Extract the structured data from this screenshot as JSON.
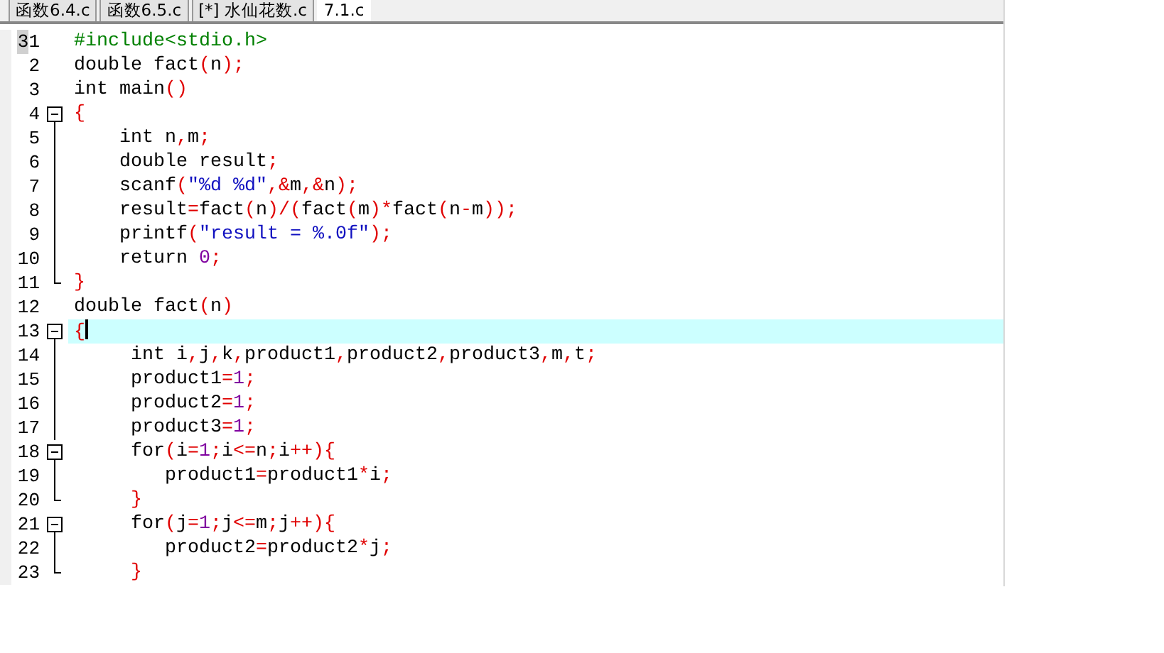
{
  "tabs": [
    {
      "label": "函数6.4.c",
      "selected": false
    },
    {
      "label": "函数6.5.c",
      "selected": false
    },
    {
      "label": "[*] 水仙花数.c",
      "selected": false
    },
    {
      "label": "7.1.c",
      "selected": true
    }
  ],
  "editor": {
    "lines": [
      {
        "number": "1",
        "marker": "3",
        "kind": "plain",
        "current": false,
        "tokens": [
          {
            "text": "#include<stdio.h>",
            "kind": "pre"
          }
        ]
      },
      {
        "number": "2",
        "kind": "plain",
        "current": false,
        "tokens": [
          {
            "text": "double fact",
            "kind": "id"
          },
          {
            "text": "(",
            "kind": "op"
          },
          {
            "text": "n",
            "kind": "id"
          },
          {
            "text": ");",
            "kind": "op"
          }
        ]
      },
      {
        "number": "3",
        "kind": "plain",
        "current": false,
        "tokens": [
          {
            "text": "int main",
            "kind": "id"
          },
          {
            "text": "()",
            "kind": "op"
          }
        ]
      },
      {
        "number": "4",
        "kind": "start",
        "current": false,
        "tokens": [
          {
            "text": "{",
            "kind": "op"
          }
        ]
      },
      {
        "number": "5",
        "kind": "mid",
        "current": false,
        "tokens": [
          {
            "text": "    int n",
            "kind": "id"
          },
          {
            "text": ",",
            "kind": "op"
          },
          {
            "text": "m",
            "kind": "id"
          },
          {
            "text": ";",
            "kind": "op"
          }
        ]
      },
      {
        "number": "6",
        "kind": "mid",
        "current": false,
        "tokens": [
          {
            "text": "    double result",
            "kind": "id"
          },
          {
            "text": ";",
            "kind": "op"
          }
        ]
      },
      {
        "number": "7",
        "kind": "mid",
        "current": false,
        "tokens": [
          {
            "text": "    scanf",
            "kind": "id"
          },
          {
            "text": "(",
            "kind": "op"
          },
          {
            "text": "\"%d %d\"",
            "kind": "str"
          },
          {
            "text": ",&",
            "kind": "op"
          },
          {
            "text": "m",
            "kind": "id"
          },
          {
            "text": ",&",
            "kind": "op"
          },
          {
            "text": "n",
            "kind": "id"
          },
          {
            "text": ");",
            "kind": "op"
          }
        ]
      },
      {
        "number": "8",
        "kind": "mid",
        "current": false,
        "tokens": [
          {
            "text": "    result",
            "kind": "id"
          },
          {
            "text": "=",
            "kind": "op"
          },
          {
            "text": "fact",
            "kind": "id"
          },
          {
            "text": "(",
            "kind": "op"
          },
          {
            "text": "n",
            "kind": "id"
          },
          {
            "text": ")/(",
            "kind": "op"
          },
          {
            "text": "fact",
            "kind": "id"
          },
          {
            "text": "(",
            "kind": "op"
          },
          {
            "text": "m",
            "kind": "id"
          },
          {
            "text": ")*",
            "kind": "op"
          },
          {
            "text": "fact",
            "kind": "id"
          },
          {
            "text": "(",
            "kind": "op"
          },
          {
            "text": "n",
            "kind": "id"
          },
          {
            "text": "-",
            "kind": "op"
          },
          {
            "text": "m",
            "kind": "id"
          },
          {
            "text": "));",
            "kind": "op"
          }
        ]
      },
      {
        "number": "9",
        "kind": "mid",
        "current": false,
        "tokens": [
          {
            "text": "    printf",
            "kind": "id"
          },
          {
            "text": "(",
            "kind": "op"
          },
          {
            "text": "\"result = %.0f\"",
            "kind": "str"
          },
          {
            "text": ");",
            "kind": "op"
          }
        ]
      },
      {
        "number": "10",
        "kind": "mid",
        "current": false,
        "tokens": [
          {
            "text": "    return ",
            "kind": "id"
          },
          {
            "text": "0",
            "kind": "num"
          },
          {
            "text": ";",
            "kind": "op"
          }
        ]
      },
      {
        "number": "11",
        "kind": "end",
        "current": false,
        "tokens": [
          {
            "text": "}",
            "kind": "op"
          }
        ]
      },
      {
        "number": "12",
        "kind": "plain",
        "current": false,
        "tokens": [
          {
            "text": "double fact",
            "kind": "id"
          },
          {
            "text": "(",
            "kind": "op"
          },
          {
            "text": "n",
            "kind": "id"
          },
          {
            "text": ")",
            "kind": "op"
          }
        ]
      },
      {
        "number": "13",
        "kind": "start",
        "current": true,
        "tokens": [
          {
            "text": "{",
            "kind": "op"
          }
        ]
      },
      {
        "number": "14",
        "kind": "mid",
        "current": false,
        "tokens": [
          {
            "text": "     int i",
            "kind": "id"
          },
          {
            "text": ",",
            "kind": "op"
          },
          {
            "text": "j",
            "kind": "id"
          },
          {
            "text": ",",
            "kind": "op"
          },
          {
            "text": "k",
            "kind": "id"
          },
          {
            "text": ",",
            "kind": "op"
          },
          {
            "text": "product1",
            "kind": "id"
          },
          {
            "text": ",",
            "kind": "op"
          },
          {
            "text": "product2",
            "kind": "id"
          },
          {
            "text": ",",
            "kind": "op"
          },
          {
            "text": "product3",
            "kind": "id"
          },
          {
            "text": ",",
            "kind": "op"
          },
          {
            "text": "m",
            "kind": "id"
          },
          {
            "text": ",",
            "kind": "op"
          },
          {
            "text": "t",
            "kind": "id"
          },
          {
            "text": ";",
            "kind": "op"
          }
        ]
      },
      {
        "number": "15",
        "kind": "mid",
        "current": false,
        "tokens": [
          {
            "text": "     product1",
            "kind": "id"
          },
          {
            "text": "=",
            "kind": "op"
          },
          {
            "text": "1",
            "kind": "num"
          },
          {
            "text": ";",
            "kind": "op"
          }
        ]
      },
      {
        "number": "16",
        "kind": "mid",
        "current": false,
        "tokens": [
          {
            "text": "     product2",
            "kind": "id"
          },
          {
            "text": "=",
            "kind": "op"
          },
          {
            "text": "1",
            "kind": "num"
          },
          {
            "text": ";",
            "kind": "op"
          }
        ]
      },
      {
        "number": "17",
        "kind": "mid",
        "current": false,
        "tokens": [
          {
            "text": "     product3",
            "kind": "id"
          },
          {
            "text": "=",
            "kind": "op"
          },
          {
            "text": "1",
            "kind": "num"
          },
          {
            "text": ";",
            "kind": "op"
          }
        ]
      },
      {
        "number": "18",
        "kind": "start",
        "current": false,
        "tokens": [
          {
            "text": "     for",
            "kind": "id"
          },
          {
            "text": "(",
            "kind": "op"
          },
          {
            "text": "i",
            "kind": "id"
          },
          {
            "text": "=",
            "kind": "op"
          },
          {
            "text": "1",
            "kind": "num"
          },
          {
            "text": ";",
            "kind": "op"
          },
          {
            "text": "i",
            "kind": "id"
          },
          {
            "text": "<=",
            "kind": "op"
          },
          {
            "text": "n",
            "kind": "id"
          },
          {
            "text": ";",
            "kind": "op"
          },
          {
            "text": "i",
            "kind": "id"
          },
          {
            "text": "++){",
            "kind": "op"
          }
        ]
      },
      {
        "number": "19",
        "kind": "mid",
        "current": false,
        "tokens": [
          {
            "text": "        product1",
            "kind": "id"
          },
          {
            "text": "=",
            "kind": "op"
          },
          {
            "text": "product1",
            "kind": "id"
          },
          {
            "text": "*",
            "kind": "op"
          },
          {
            "text": "i",
            "kind": "id"
          },
          {
            "text": ";",
            "kind": "op"
          }
        ]
      },
      {
        "number": "20",
        "kind": "end",
        "current": false,
        "tokens": [
          {
            "text": "     }",
            "kind": "op"
          }
        ]
      },
      {
        "number": "21",
        "kind": "start",
        "current": false,
        "tokens": [
          {
            "text": "     for",
            "kind": "id"
          },
          {
            "text": "(",
            "kind": "op"
          },
          {
            "text": "j",
            "kind": "id"
          },
          {
            "text": "=",
            "kind": "op"
          },
          {
            "text": "1",
            "kind": "num"
          },
          {
            "text": ";",
            "kind": "op"
          },
          {
            "text": "j",
            "kind": "id"
          },
          {
            "text": "<=",
            "kind": "op"
          },
          {
            "text": "m",
            "kind": "id"
          },
          {
            "text": ";",
            "kind": "op"
          },
          {
            "text": "j",
            "kind": "id"
          },
          {
            "text": "++){",
            "kind": "op"
          }
        ]
      },
      {
        "number": "22",
        "kind": "mid",
        "current": false,
        "tokens": [
          {
            "text": "        product2",
            "kind": "id"
          },
          {
            "text": "=",
            "kind": "op"
          },
          {
            "text": "product2",
            "kind": "id"
          },
          {
            "text": "*",
            "kind": "op"
          },
          {
            "text": "j",
            "kind": "id"
          },
          {
            "text": ";",
            "kind": "op"
          }
        ]
      },
      {
        "number": "23",
        "kind": "end",
        "current": false,
        "tokens": [
          {
            "text": "     }",
            "kind": "op"
          }
        ]
      }
    ]
  }
}
